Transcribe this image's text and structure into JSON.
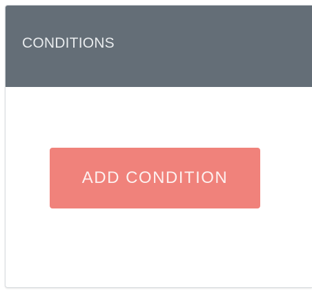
{
  "panel": {
    "title": "CONDITIONS",
    "header_color": "#646e77"
  },
  "actions": {
    "add_condition_label": "ADD CONDITION",
    "add_condition_color": "#f0827b"
  }
}
